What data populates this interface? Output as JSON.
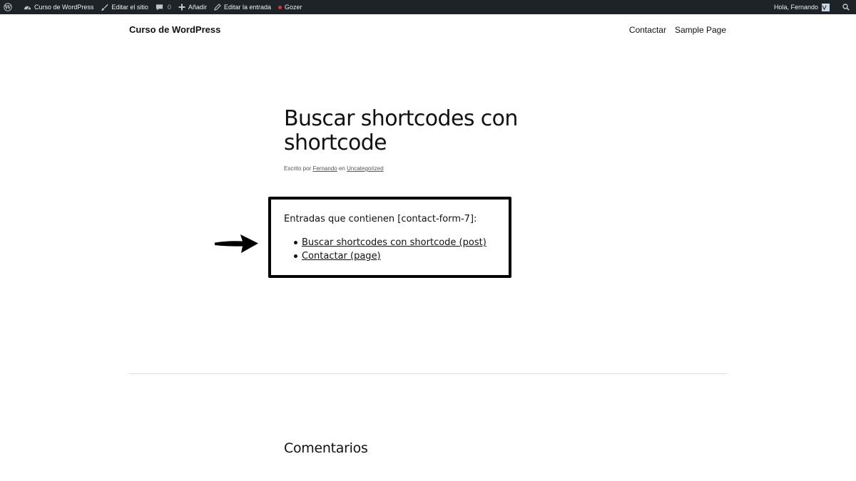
{
  "admin_bar": {
    "site_name": "Curso de WordPress",
    "edit_site": "Editar el sitio",
    "comments_count": "0",
    "add_new": "Añadir",
    "edit_post": "Editar la entrada",
    "plugin": "Gozer",
    "greeting": "Hola, Fernando"
  },
  "header": {
    "site_title": "Curso de WordPress",
    "nav": [
      "Contactar",
      "Sample Page"
    ]
  },
  "post": {
    "title_line1": "Buscar shortcodes con",
    "title_line2": "shortcode",
    "meta_prefix": "Escrito por",
    "author": "Fernando",
    "meta_in": "en",
    "category": "Uncategorized"
  },
  "shortcode_results": {
    "heading": "Entradas que contienen [contact-form-7]:",
    "items": [
      "Buscar shortcodes con shortcode (post)",
      "Contactar (page)"
    ]
  },
  "comments": {
    "title": "Comentarios"
  },
  "colors": {
    "admin_bar_bg": "#1d2327",
    "status_dot": "#d63638"
  }
}
